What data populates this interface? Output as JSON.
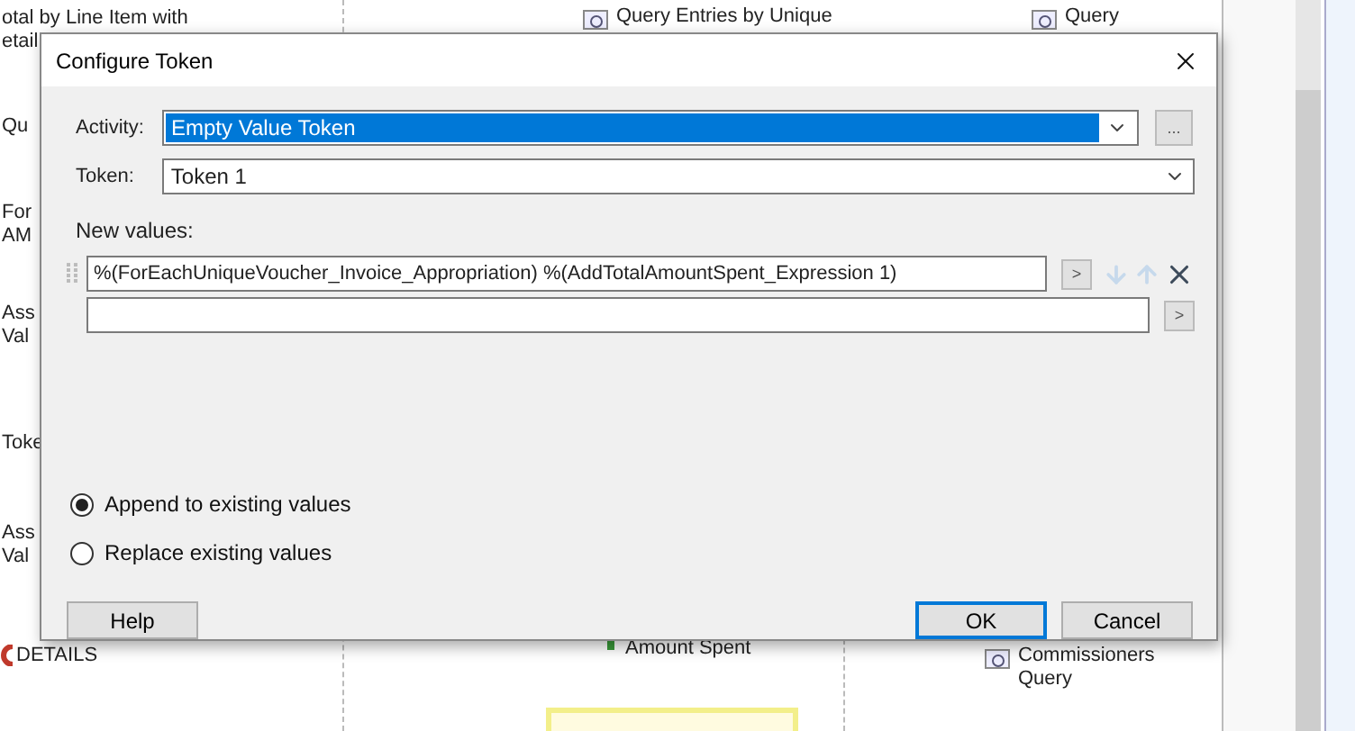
{
  "canvas": {
    "labels": [
      {
        "kind": "text",
        "lines": [
          "otal by Line Item with",
          "etail"
        ]
      },
      {
        "kind": "query",
        "lines": [
          "Query Entries by Unique"
        ]
      },
      {
        "kind": "query",
        "lines": [
          "Query"
        ]
      },
      {
        "kind": "text",
        "lines": [
          "Qu"
        ]
      },
      {
        "kind": "text",
        "lines": [
          "For",
          "AM"
        ]
      },
      {
        "kind": "text",
        "lines": [
          "Ass",
          "Val"
        ]
      },
      {
        "kind": "text",
        "lines": [
          "Toke"
        ]
      },
      {
        "kind": "text",
        "lines": [
          "Ass",
          "Val"
        ]
      },
      {
        "kind": "loop",
        "lines": [
          "DETAILS"
        ]
      },
      {
        "kind": "step",
        "lines": [
          "Amount Spent"
        ]
      },
      {
        "kind": "query",
        "lines": [
          "Commissioners",
          "Query"
        ]
      }
    ]
  },
  "dialog": {
    "title": "Configure Token",
    "activity": {
      "label": "Activity:",
      "value": "Empty Value Token",
      "highlighted": true,
      "button": "..."
    },
    "token": {
      "label": "Token:",
      "value": "Token 1"
    },
    "new_values": {
      "label": "New values:",
      "rows": [
        {
          "value": "%(ForEachUniqueVoucher_Invoice_Appropriation) %(AddTotalAmountSpent_Expression 1)",
          "button": ">",
          "reorder": true
        },
        {
          "button": ">",
          "reorder": false
        }
      ]
    },
    "options": [
      {
        "label": "Append to existing values",
        "selected": true
      },
      {
        "label": "Replace existing values",
        "selected": false
      }
    ],
    "buttons": [
      {
        "label": "Help",
        "kind": "left",
        "default": false
      },
      {
        "label": "OK",
        "kind": "right",
        "default": true
      },
      {
        "label": "Cancel",
        "kind": "right",
        "default": false
      }
    ]
  }
}
